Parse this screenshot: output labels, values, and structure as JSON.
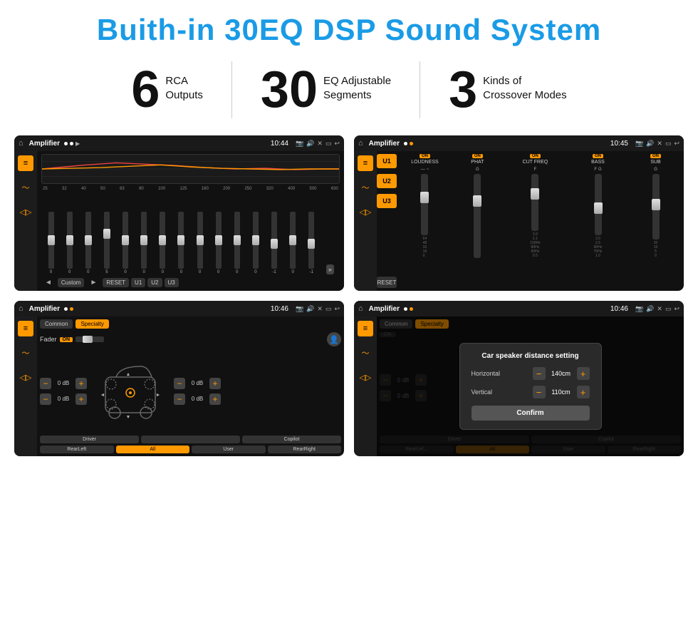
{
  "header": {
    "title": "Buith-in 30EQ DSP Sound System"
  },
  "stats": [
    {
      "number": "6",
      "line1": "RCA",
      "line2": "Outputs"
    },
    {
      "number": "30",
      "line1": "EQ Adjustable",
      "line2": "Segments"
    },
    {
      "number": "3",
      "line1": "Kinds of",
      "line2": "Crossover Modes"
    }
  ],
  "screens": {
    "eq": {
      "status": {
        "title": "Amplifier",
        "time": "10:44"
      },
      "freq_labels": [
        "25",
        "32",
        "40",
        "50",
        "63",
        "80",
        "100",
        "125",
        "160",
        "200",
        "250",
        "320",
        "400",
        "500",
        "630"
      ],
      "slider_values": [
        "0",
        "0",
        "0",
        "5",
        "0",
        "0",
        "0",
        "0",
        "0",
        "0",
        "0",
        "0",
        "-1",
        "0",
        "-1"
      ],
      "buttons": [
        "◄",
        "Custom",
        "►",
        "RESET",
        "U1",
        "U2",
        "U3"
      ]
    },
    "amp": {
      "status": {
        "title": "Amplifier",
        "time": "10:45"
      },
      "u_buttons": [
        "U1",
        "U2",
        "U3"
      ],
      "reset_label": "RESET",
      "channels": [
        "LOUDNESS",
        "PHAT",
        "CUT FREQ",
        "BASS",
        "SUB"
      ],
      "on_label": "ON"
    },
    "fader": {
      "status": {
        "title": "Amplifier",
        "time": "10:46"
      },
      "tabs": [
        "Common",
        "Specialty"
      ],
      "fader_label": "Fader",
      "on_label": "ON",
      "vol_labels": [
        "0 dB",
        "0 dB",
        "0 dB",
        "0 dB"
      ],
      "bottom_buttons": [
        "Driver",
        "",
        "Copilot",
        "RearLeft",
        "All",
        "User",
        "RearRight"
      ]
    },
    "dialog": {
      "status": {
        "title": "Amplifier",
        "time": "10:46"
      },
      "tabs": [
        "Common",
        "Specialty"
      ],
      "dialog_title": "Car speaker distance setting",
      "horizontal_label": "Horizontal",
      "horizontal_value": "140cm",
      "vertical_label": "Vertical",
      "vertical_value": "110cm",
      "confirm_label": "Confirm",
      "db_labels": [
        "0 dB",
        "0 dB"
      ],
      "bottom_buttons": [
        "Driver",
        "Copilot",
        "RearLef...",
        "User",
        "RearRight"
      ]
    }
  }
}
